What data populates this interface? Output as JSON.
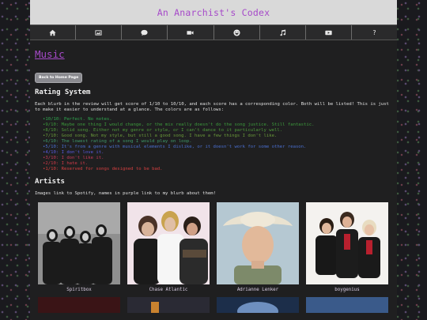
{
  "site": {
    "title": "An Anarchist's Codex"
  },
  "nav": [
    {
      "icon": "home-icon",
      "label": ""
    },
    {
      "icon": "image-icon",
      "label": ""
    },
    {
      "icon": "chat-icon",
      "label": ""
    },
    {
      "icon": "video-icon",
      "label": ""
    },
    {
      "icon": "smiley-icon",
      "label": ""
    },
    {
      "icon": "music-icon",
      "label": ""
    },
    {
      "icon": "youtube-icon",
      "label": ""
    },
    {
      "icon": "question-icon",
      "label": "?"
    }
  ],
  "page": {
    "title": "Music",
    "back_button": "Back to Home Page"
  },
  "rating": {
    "heading": "Rating System",
    "intro": "Each blurb in the review will get score of 1/10 to 10/10, and each score has a corresponding color. Both will be listed! This is just to make it easier to understand at a glance. The colors are as follows:",
    "items": [
      {
        "text": "10/10: Perfect. No notes.",
        "color": "#2fa84f"
      },
      {
        "text": "9/10: Maybe one thing I would change, or the mix really doesn't do the song justice. Still fantastic.",
        "color": "#3c9a3c"
      },
      {
        "text": "8/10: Solid song. Either not my genre or style, or I can't dance to it particularly well.",
        "color": "#4f9a3a"
      },
      {
        "text": "7/10: Good song. Not my style, but still a good song. I have a few things I don't like.",
        "color": "#6a9a3a"
      },
      {
        "text": "6/10: The lowest rating of a song I would play on loop.",
        "color": "#3f9a6a"
      },
      {
        "text": "5/10: It's from a genre with musical elements I dislike, or it doesn't work for some other reason.",
        "color": "#4a6fd0"
      },
      {
        "text": "4/10: I don't love it.",
        "color": "#5a5ae0"
      },
      {
        "text": "3/10: I don't like it.",
        "color": "#c43a5a"
      },
      {
        "text": "2/10: I hate it.",
        "color": "#d03a4a"
      },
      {
        "text": "1/10: Reserved for songs designed to be bad.",
        "color": "#d64040"
      }
    ]
  },
  "artists": {
    "heading": "Artists",
    "intro": "Images link to Spotify, names in purple link to my blurb about them!",
    "items": [
      {
        "name": "Spiritbox"
      },
      {
        "name": "Chase Atlantic"
      },
      {
        "name": "Adrianne Lenker"
      },
      {
        "name": "boygenius"
      }
    ]
  }
}
